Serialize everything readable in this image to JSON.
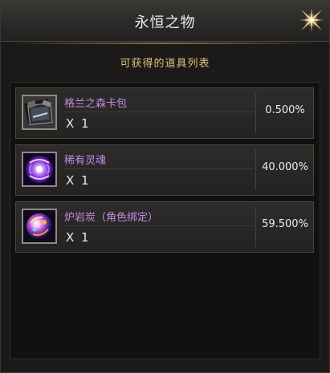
{
  "window": {
    "title": "永恒之物",
    "close_icon": "close-star-icon"
  },
  "subtitle": "可获得的道具列表",
  "items": [
    {
      "name": "格兰之森卡包",
      "quantity": "X 1",
      "probability": "0.500%",
      "icon": "card-pack-icon"
    },
    {
      "name": "稀有灵魂",
      "quantity": "X 1",
      "probability": "40.000%",
      "icon": "rare-soul-icon"
    },
    {
      "name": "炉岩炭（角色绑定）",
      "quantity": "X 1",
      "probability": "59.500%",
      "icon": "lava-coal-orb-icon"
    }
  ],
  "colors": {
    "title_text": "#ececec",
    "subtitle_text": "#e3c17a",
    "item_name_text": "#c28be6",
    "value_text": "#ececec",
    "background": "#1b1a19"
  }
}
